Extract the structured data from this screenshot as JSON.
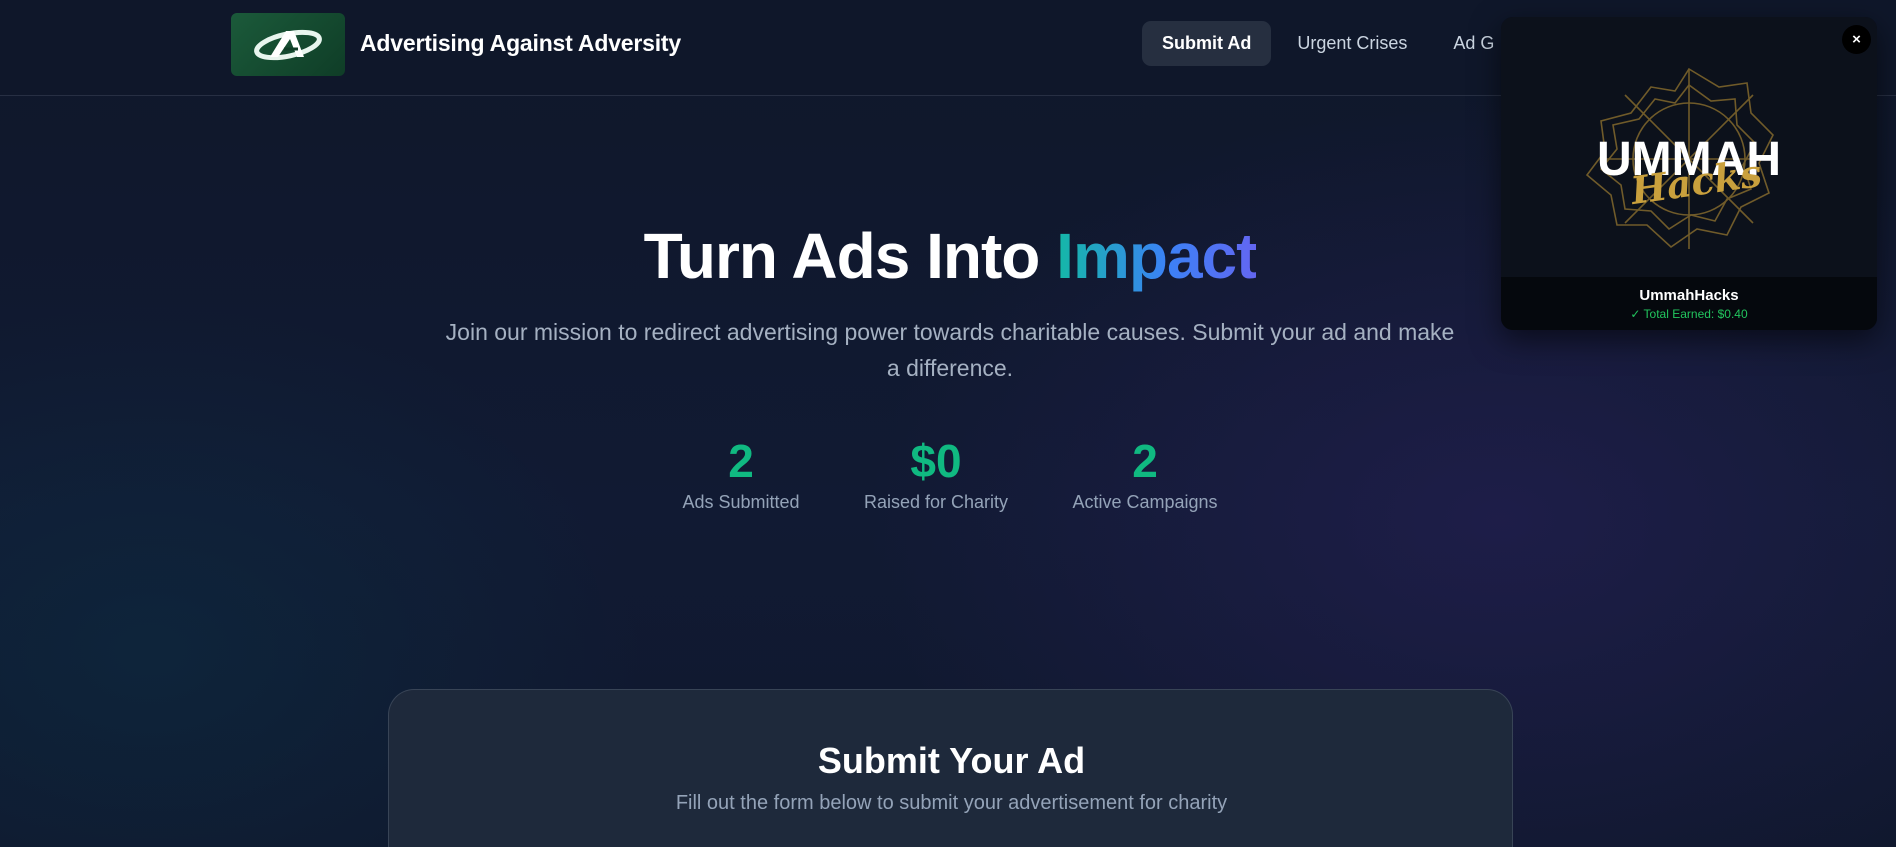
{
  "header": {
    "site_title": "Advertising Against Adversity",
    "nav": [
      {
        "label": "Submit Ad",
        "active": true
      },
      {
        "label": "Urgent Crises",
        "active": false
      },
      {
        "label": "Ad G",
        "active": false
      }
    ]
  },
  "hero": {
    "title_prefix": "Turn Ads Into ",
    "title_accent": "Impact",
    "subtitle": "Join our mission to redirect advertising power towards charitable causes. Submit your ad and make a difference."
  },
  "stats": [
    {
      "value": "2",
      "label": "Ads Submitted"
    },
    {
      "value": "$0",
      "label": "Raised for Charity"
    },
    {
      "value": "2",
      "label": "Active Campaigns"
    }
  ],
  "form_card": {
    "title": "Submit Your Ad",
    "subtitle": "Fill out the form below to submit your advertisement for charity"
  },
  "popup_ad": {
    "art_word_main": "UMMAH",
    "art_word_script": "Hacks",
    "name": "UmmahHacks",
    "earned": "✓ Total Earned: $0.40",
    "close_label": "×"
  },
  "colors": {
    "accent_green": "#10b981",
    "background": "#0f172a",
    "card": "#1e293b",
    "gold": "#c9a03d"
  }
}
